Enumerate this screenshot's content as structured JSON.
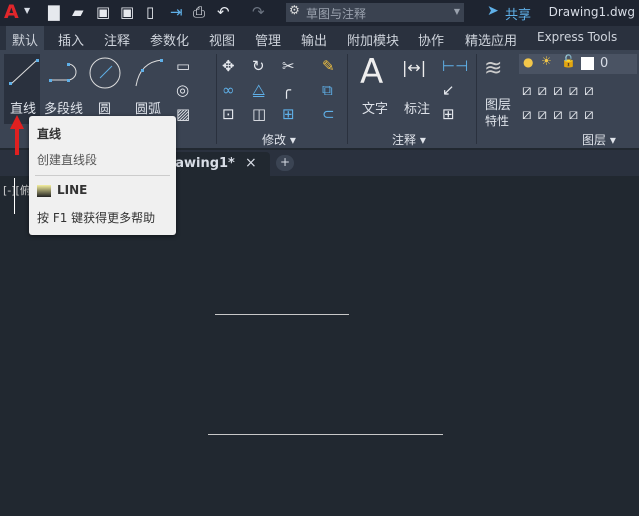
{
  "titlebar": {
    "logo": "A",
    "search_placeholder": "草图与注释",
    "share": "共享",
    "document_title": "Drawing1.dwg"
  },
  "tabs": [
    "默认",
    "插入",
    "注释",
    "参数化",
    "视图",
    "管理",
    "输出",
    "附加模块",
    "协作",
    "精选应用",
    "Express Tools"
  ],
  "ribbon": {
    "draw": {
      "line": "直线",
      "polyline": "多段线",
      "circle": "圆",
      "arc": "圆弧"
    },
    "modify": {
      "label": "修改"
    },
    "annotation": {
      "text": "文字",
      "dimension": "标注",
      "label": "注释"
    },
    "layers": {
      "properties_line1": "图层",
      "properties_line2": "特性",
      "current_layer": "0",
      "label": "图层"
    }
  },
  "file_tab": {
    "title": "Drawing1*",
    "close": "×",
    "new": "+"
  },
  "viewport": {
    "label": "[-][俯"
  },
  "tooltip": {
    "title": "直线",
    "description": "创建直线段",
    "command": "LINE",
    "help": "按 F1 键获得更多帮助"
  },
  "colors": {
    "accent": "#5fb0e8",
    "logo": "#e0262b",
    "canvas": "#212830"
  }
}
